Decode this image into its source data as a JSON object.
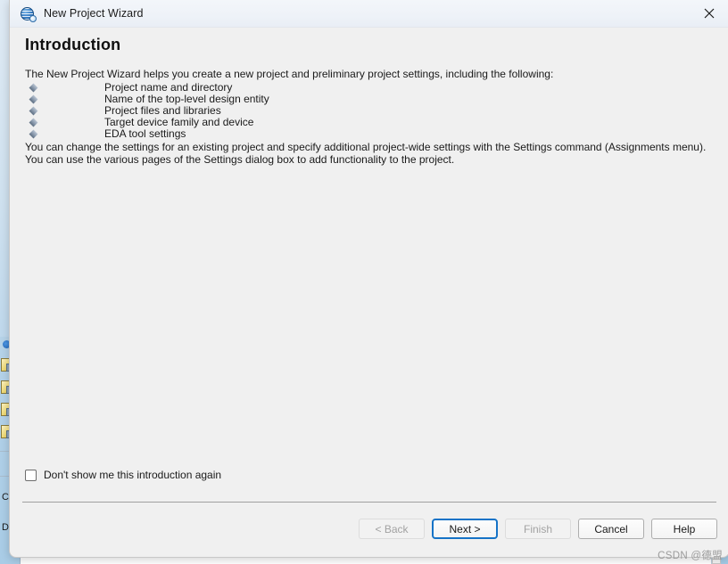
{
  "window": {
    "title": "New Project Wizard",
    "icon": "quartus-globe-icon",
    "close_label": "✕"
  },
  "page": {
    "title": "Introduction",
    "intro": "The New Project Wizard helps you create a new project and preliminary project settings, including the following:",
    "bullets": [
      "Project name and directory",
      "Name of the top-level design entity",
      "Project files and libraries",
      "Target device family and device",
      "EDA tool settings"
    ],
    "paragraph": "You can change the settings for an existing project and specify additional project-wide settings with the Settings command (Assignments menu). You can use the various pages of the Settings dialog box to add functionality to the project."
  },
  "options": {
    "dont_show_again": {
      "label": "Don't show me this introduction again",
      "checked": false
    }
  },
  "buttons": [
    {
      "label": "< Back",
      "name": "back-button",
      "state": "disabled"
    },
    {
      "label": "Next >",
      "name": "next-button",
      "state": "default"
    },
    {
      "label": "Finish",
      "name": "finish-button",
      "state": "disabled"
    },
    {
      "label": "Cancel",
      "name": "cancel-button",
      "state": "normal"
    },
    {
      "label": "Help",
      "name": "help-button",
      "state": "normal"
    }
  ],
  "watermark": "CSDN @德盟",
  "background": {
    "left_labels": [
      "Cl",
      "Do"
    ]
  },
  "colors": {
    "dialog_body": "#f0f0f0",
    "titlebar": "#eef2f8",
    "accent_focus": "#1673c7",
    "text": "#1a1a1a",
    "disabled_text": "#a2a2a2",
    "bullet": "#8c9bae",
    "desktop_blue": "#b3d3ea"
  }
}
